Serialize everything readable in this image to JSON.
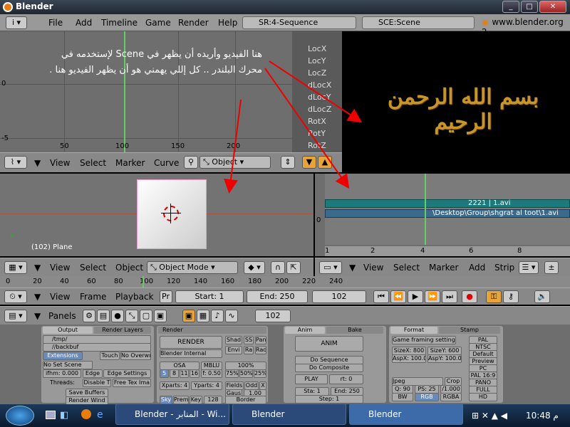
{
  "window": {
    "title": "Blender",
    "url": "www.blender.org 2"
  },
  "menus": [
    "File",
    "Add",
    "Timeline",
    "Game",
    "Render",
    "Help"
  ],
  "screen": "SR:4-Sequence",
  "scene": "SCE:Scene",
  "arabic_note": "هنا الفيديو وأريده أن يظهر في Scene لإستخدمه في محرك البلندر .. كل إللي يهمني هو أن يظهر الفيديو هنا .",
  "ipo": {
    "y_labels": [
      "0",
      "-5"
    ],
    "x_labels": [
      "50",
      "100",
      "150",
      "200"
    ],
    "channels": [
      "LocX",
      "LocY",
      "LocZ",
      "dLocX",
      "dLocY",
      "dLocZ",
      "RotX",
      "RotY",
      "RotZ"
    ],
    "header": [
      "View",
      "Select",
      "Marker",
      "Curve"
    ],
    "object_label": "Object"
  },
  "preview_text": "بسم الله الرحمن الرحيم",
  "view3d": {
    "info": "(102) Plane",
    "header": [
      "View",
      "Select",
      "Object"
    ],
    "mode": "Object Mode"
  },
  "sequencer": {
    "strip_label": "2221 | 1.avi",
    "strip_path": "\\Desktop\\Group\\shgrat al toot\\1.avi",
    "y_label": "0",
    "x_labels": [
      "1",
      "2",
      "4",
      "6",
      "8"
    ],
    "header": [
      "View",
      "Select",
      "Marker",
      "Add",
      "Strip"
    ]
  },
  "timeline": {
    "ticks": [
      "0",
      "20",
      "40",
      "60",
      "80",
      "100",
      "120",
      "140",
      "160",
      "180",
      "200",
      "220",
      "240"
    ],
    "header": [
      "View",
      "Frame",
      "Playback"
    ],
    "pr": "Pr",
    "start": "Start: 1",
    "end": "End: 250",
    "current": "102"
  },
  "buttons_header": {
    "panels": "Panels",
    "frame": "102"
  },
  "output": {
    "tab1": "Output",
    "tab2": "Render Layers",
    "path1": "/tmp/",
    "path2": "//backbuf",
    "extensions": "Extensions",
    "touch": "Touch",
    "no_overwrite": "No Overwri",
    "no_set_scene": "No Set Scene",
    "ifhm": "ifhm: 0.000",
    "edge": "Edge",
    "edge_settings": "Edge Settings",
    "threads": "Threads:",
    "disable_t": "Disable T",
    "free_tex": "Free Tex Ima",
    "save_buffers": "Save Buffers",
    "render_wind": "Render Wind"
  },
  "render": {
    "tab": "Render",
    "render_btn": "RENDER",
    "shad": "Shad",
    "ss": "SS",
    "pan": "Pan",
    "engine": "Blender Internal",
    "envi": "Envi",
    "ra": "Ra",
    "rad": "Rad",
    "osa": "OSA",
    "mblu": "MBLU",
    "pct": "100%",
    "osa_vals": [
      "5",
      "8",
      "11",
      "16"
    ],
    "f": "f: 0.50",
    "pcts": [
      "75%",
      "50%",
      "25%"
    ],
    "xparts": "Xparts: 4",
    "yparts": "Yparts: 4",
    "fields": "Fields",
    "odd": "Odd",
    "x": "X",
    "gaus": "Gaus",
    "gaus_val": "1.00",
    "sky": "Sky",
    "prem": "Prem",
    "key": "Key",
    "v128": "128",
    "border": "Border"
  },
  "anim": {
    "tab1": "Anim",
    "tab2": "Bake",
    "anim_btn": "ANIM",
    "do_seq": "Do Sequence",
    "do_comp": "Do Composite",
    "play": "PLAY",
    "rt": "rt: 0",
    "sta": "Sta: 1",
    "end": "End: 250",
    "step": "Step: 1"
  },
  "format": {
    "tab1": "Format",
    "tab2": "Stamp",
    "game_framing": "Game framing settings",
    "sizex": "SizeX: 800",
    "sizey": "SizeY: 600",
    "aspx": "AspX: 100.00",
    "aspy": "AspY: 100.00",
    "jpeg": "Jpeg",
    "crop": "Crop",
    "q": "Q: 90",
    "ps": "PS: 25",
    "fps": "/1.000",
    "bw": "BW",
    "rgb": "RGB",
    "rgba": "RGBA",
    "presets": [
      "PAL",
      "NTSC",
      "Default",
      "Preview",
      "PC",
      "PAL 16:9",
      "PANO",
      "FULL",
      "HD"
    ]
  },
  "taskbar": {
    "task1": "Blender - المنابر - Wi...",
    "task2": "Blender",
    "task3": "Blender",
    "time": "10:48 م"
  }
}
